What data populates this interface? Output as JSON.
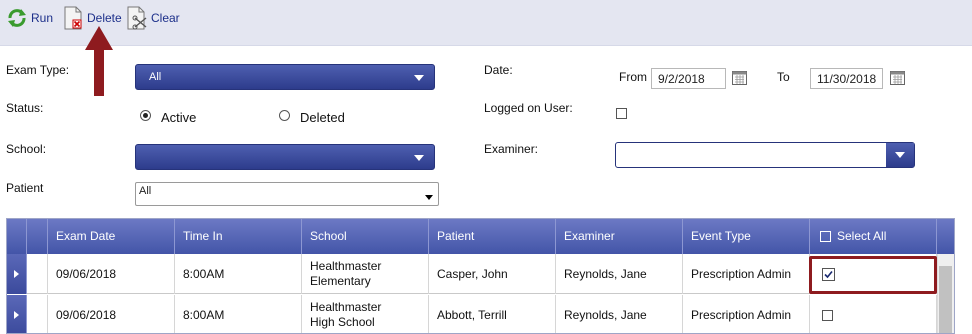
{
  "toolbar": {
    "run_label": "Run",
    "delete_label": "Delete",
    "clear_label": "Clear"
  },
  "filters": {
    "exam_type_label": "Exam Type:",
    "exam_type_value": "All",
    "status_label": "Status:",
    "status_active": "Active",
    "status_deleted": "Deleted",
    "school_label": "School:",
    "patient_label": "Patient",
    "patient_value": "All",
    "date_label": "Date:",
    "from_label": "From",
    "from_value": "9/2/2018",
    "to_label": "To",
    "to_value": "11/30/2018",
    "logged_label": "Logged on User:",
    "examiner_label": "Examiner:"
  },
  "grid": {
    "headers": [
      "Exam Date",
      "Time In",
      "School",
      "Patient",
      "Examiner",
      "Event Type",
      "Select All"
    ],
    "rows": [
      [
        "09/06/2018",
        "8:00AM",
        "Healthmaster Elementary",
        "Casper, John",
        "Reynolds, Jane",
        "Prescription Admin"
      ],
      [
        "09/06/2018",
        "8:00AM",
        "Healthmaster High School",
        "Abbott, Terrill",
        "Reynolds, Jane",
        "Prescription Admin"
      ]
    ]
  },
  "colors": {
    "header_blue": "#4355a8",
    "annotation_red": "#8e1b1f",
    "toolbar_bg": "#e4e6f1"
  },
  "icons": [
    "refresh-icon",
    "delete-document-icon",
    "clear-icon",
    "calendar-icon",
    "expand-arrow-icon",
    "red-arrow-annotation"
  ]
}
